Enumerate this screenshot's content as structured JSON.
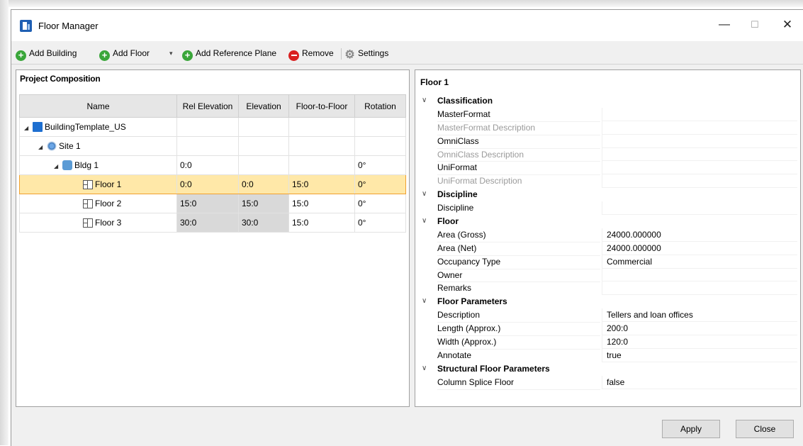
{
  "window": {
    "title": "Floor Manager",
    "minimize": "—",
    "maximize": "☐",
    "close": "✕"
  },
  "toolbar": {
    "add_building": "Add Building",
    "add_floor": "Add Floor",
    "add_floor_dropdown": "▾",
    "add_reference_plane": "Add Reference Plane",
    "remove": "Remove",
    "settings": "Settings"
  },
  "left_pane": {
    "title": "Project Composition",
    "columns": [
      "Name",
      "Rel Elevation",
      "Elevation",
      "Floor-to-Floor",
      "Rotation"
    ],
    "rows": [
      {
        "name": "BuildingTemplate_US",
        "icon": "building-template-icon",
        "level": 0,
        "rel": "",
        "elev": "",
        "f2f": "",
        "rot": ""
      },
      {
        "name": "Site 1",
        "icon": "site-icon",
        "level": 1,
        "rel": "",
        "elev": "",
        "f2f": "",
        "rot": ""
      },
      {
        "name": "Bldg 1",
        "icon": "building-icon",
        "level": 2,
        "rel": "0:0",
        "elev": "",
        "f2f": "",
        "rot": "0°"
      },
      {
        "name": "Floor 1",
        "icon": "floor-icon",
        "level": 3,
        "rel": "0:0",
        "elev": "0:0",
        "f2f": "15:0",
        "rot": "0°",
        "selected": true
      },
      {
        "name": "Floor 2",
        "icon": "floor-icon",
        "level": 3,
        "rel": "15:0",
        "elev": "15:0",
        "f2f": "15:0",
        "rot": "0°"
      },
      {
        "name": "Floor 3",
        "icon": "floor-icon",
        "level": 3,
        "rel": "30:0",
        "elev": "30:0",
        "f2f": "15:0",
        "rot": "0°"
      }
    ]
  },
  "right_pane": {
    "title": "Floor 1",
    "categories": [
      {
        "name": "Classification",
        "props": [
          {
            "name": "MasterFormat",
            "value": "",
            "dim": false
          },
          {
            "name": "MasterFormat Description",
            "value": "",
            "dim": true
          },
          {
            "name": "OmniClass",
            "value": "",
            "dim": false
          },
          {
            "name": "OmniClass Description",
            "value": "",
            "dim": true
          },
          {
            "name": "UniFormat",
            "value": "",
            "dim": false
          },
          {
            "name": "UniFormat Description",
            "value": "",
            "dim": true
          }
        ]
      },
      {
        "name": "Discipline",
        "props": [
          {
            "name": "Discipline",
            "value": "",
            "dim": false
          }
        ]
      },
      {
        "name": "Floor",
        "props": [
          {
            "name": "Area (Gross)",
            "value": "24000.000000",
            "dim": false
          },
          {
            "name": "Area (Net)",
            "value": "24000.000000",
            "dim": false
          },
          {
            "name": "Occupancy Type",
            "value": "Commercial",
            "dim": false
          },
          {
            "name": "Owner",
            "value": "",
            "dim": false
          },
          {
            "name": "Remarks",
            "value": "",
            "dim": false
          }
        ]
      },
      {
        "name": "Floor Parameters",
        "props": [
          {
            "name": "Description",
            "value": "Tellers and loan offices",
            "dim": false
          },
          {
            "name": "Length (Approx.)",
            "value": "200:0",
            "dim": false
          },
          {
            "name": "Width (Approx.)",
            "value": "120:0",
            "dim": false
          },
          {
            "name": "Annotate",
            "value": "true",
            "dim": false
          }
        ]
      },
      {
        "name": "Structural Floor Parameters",
        "props": [
          {
            "name": "Column Splice Floor",
            "value": "false",
            "dim": false
          }
        ]
      }
    ]
  },
  "footer": {
    "apply": "Apply",
    "close": "Close"
  },
  "colors": {
    "selection_fill": "#ffe8a8",
    "selection_border": "#f0a030",
    "readonly_cell": "#d9d9d9",
    "add_icon": "#3aa63a",
    "remove_icon": "#d92020"
  }
}
